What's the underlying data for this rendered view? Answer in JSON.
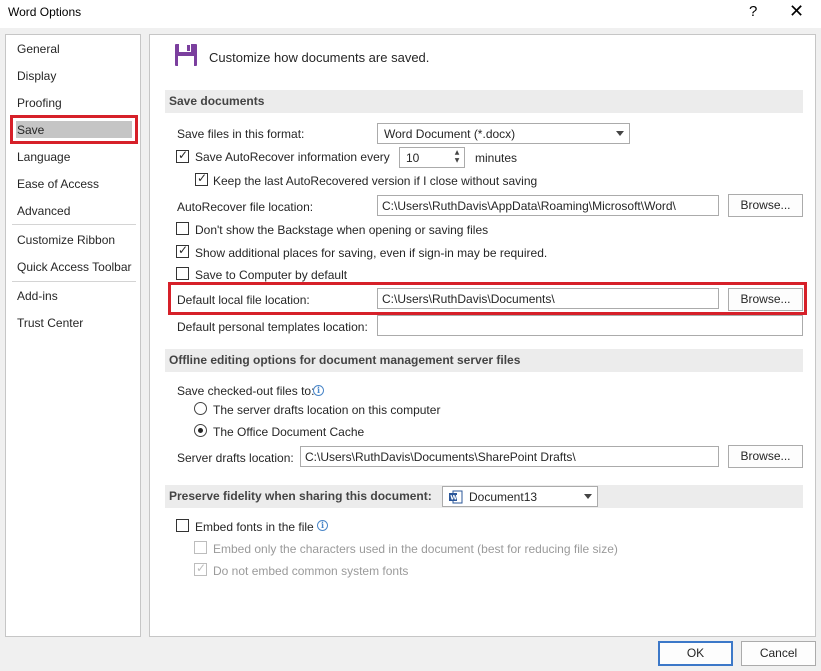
{
  "window": {
    "title": "Word Options",
    "help": "?",
    "close": "✕"
  },
  "nav": {
    "items": [
      "General",
      "Display",
      "Proofing",
      "Save",
      "Language",
      "Ease of Access",
      "Advanced",
      "Customize Ribbon",
      "Quick Access Toolbar",
      "Add-ins",
      "Trust Center"
    ],
    "selected": "Save"
  },
  "header": {
    "text": "Customize how documents are saved."
  },
  "save_documents": {
    "heading": "Save documents",
    "format_label": "Save files in this format:",
    "format_value": "Word Document (*.docx)",
    "autorecover_label": "Save AutoRecover information every",
    "autorecover_checked": true,
    "autorecover_minutes": "10",
    "minutes_label": "minutes",
    "keep_last_label": "Keep the last AutoRecovered version if I close without saving",
    "keep_last_checked": true,
    "ar_location_label": "AutoRecover file location:",
    "ar_location_value": "C:\\Users\\RuthDavis\\AppData\\Roaming\\Microsoft\\Word\\",
    "browse_label": "Browse...",
    "dont_show_backstage_label": "Don't show the Backstage when opening or saving files",
    "dont_show_backstage_checked": false,
    "show_additional_label": "Show additional places for saving, even if sign-in may be required.",
    "show_additional_checked": true,
    "save_to_computer_label": "Save to Computer by default",
    "save_to_computer_checked": false,
    "default_local_label": "Default local file location:",
    "default_local_value": "C:\\Users\\RuthDavis\\Documents\\",
    "default_templates_label": "Default personal templates location:",
    "default_templates_value": ""
  },
  "offline": {
    "heading": "Offline editing options for document management server files",
    "checked_out_label": "Save checked-out files to:",
    "radio_server": "The server drafts location on this computer",
    "radio_cache": "The Office Document Cache",
    "selected": "cache",
    "server_drafts_label": "Server drafts location:",
    "server_drafts_value": "C:\\Users\\RuthDavis\\Documents\\SharePoint Drafts\\"
  },
  "fidelity": {
    "heading": "Preserve fidelity when sharing this document:",
    "document": "Document13",
    "embed_fonts_label": "Embed fonts in the file",
    "embed_fonts_checked": false,
    "embed_only_label": "Embed only the characters used in the document (best for reducing file size)",
    "do_not_embed_label": "Do not embed common system fonts"
  },
  "footer": {
    "ok": "OK",
    "cancel": "Cancel"
  },
  "colors": {
    "highlight": "#d62029",
    "selected_nav": "#c5c5c5",
    "save_icon": "#7b3f9e"
  }
}
